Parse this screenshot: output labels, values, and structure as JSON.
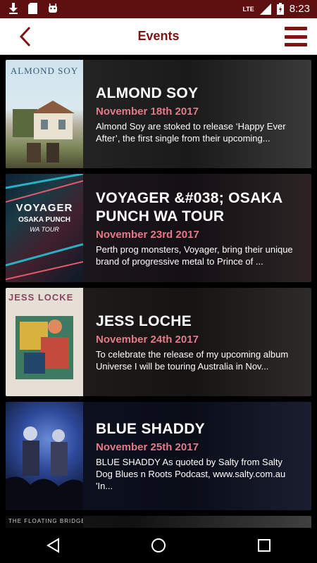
{
  "status_bar": {
    "time": "8:23",
    "network": "LTE"
  },
  "header": {
    "title": "Events"
  },
  "events": [
    {
      "title": "ALMOND SOY",
      "date": "November 18th 2017",
      "description": "Almond Soy are stoked to release ‘Happy Ever After’, the first single from their upcoming...",
      "thumb_text": "ALMOND SOY"
    },
    {
      "title": "VOYAGER &#038; OSAKA PUNCH WA TOUR",
      "date": "November 23rd 2017",
      "description": "Perth prog monsters, Voyager, bring their unique brand of progressive metal to Prince of ...",
      "thumb_text": "VOYAGER",
      "thumb_text_2": "OSAKA PUNCH",
      "thumb_text_3": "WA TOUR"
    },
    {
      "title": "JESS LOCHE",
      "date": "November 24th 2017",
      "description": "To celebrate the release of my upcoming album Universe I will be touring Australia in Nov...",
      "thumb_text": "JESS LOCKE"
    },
    {
      "title": "BLUE SHADDY",
      "date": "November 25th 2017",
      "description": "BLUE SHADDY As quoted by Salty from Salty Dog Blues n Roots Podcast, www.salty.com.au 'In..."
    },
    {
      "thumb_text": "THE FLOATING BRIDGES"
    }
  ]
}
